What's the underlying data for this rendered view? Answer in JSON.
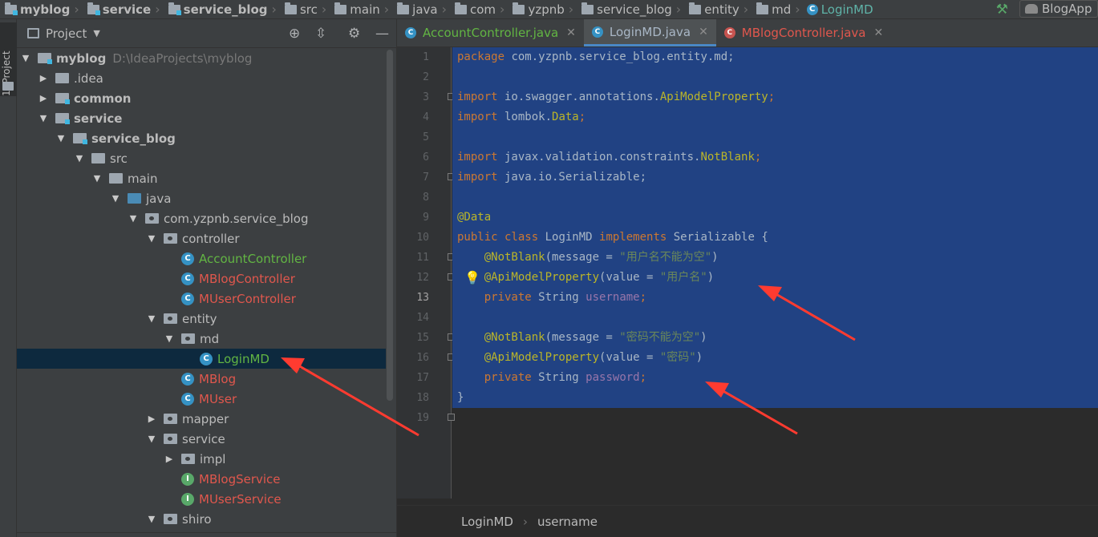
{
  "navbar": {
    "crumbs": [
      "myblog",
      "service",
      "service_blog",
      "src",
      "main",
      "java",
      "com",
      "yzpnb",
      "service_blog",
      "entity",
      "md",
      "LoginMD"
    ],
    "run_config": "BlogApp"
  },
  "strip": {
    "tab_label": "1: Project"
  },
  "project": {
    "title": "Project",
    "tree": [
      {
        "label": "myblog",
        "path": "D:\\IdeaProjects\\myblog"
      },
      {
        "label": ".idea"
      },
      {
        "label": "common"
      },
      {
        "label": "service"
      },
      {
        "label": "service_blog"
      },
      {
        "label": "src"
      },
      {
        "label": "main"
      },
      {
        "label": "java"
      },
      {
        "label": "com.yzpnb.service_blog"
      },
      {
        "label": "controller"
      },
      {
        "label": "AccountController"
      },
      {
        "label": "MBlogController"
      },
      {
        "label": "MUserController"
      },
      {
        "label": "entity"
      },
      {
        "label": "md"
      },
      {
        "label": "LoginMD"
      },
      {
        "label": "MBlog"
      },
      {
        "label": "MUser"
      },
      {
        "label": "mapper"
      },
      {
        "label": "service"
      },
      {
        "label": "impl"
      },
      {
        "label": "MBlogService"
      },
      {
        "label": "MUserService"
      },
      {
        "label": "shiro"
      }
    ]
  },
  "editor": {
    "tabs": [
      {
        "label": "AccountController.java"
      },
      {
        "label": "LoginMD.java"
      },
      {
        "label": "MBlogController.java"
      }
    ],
    "line_numbers": [
      "1",
      "2",
      "3",
      "4",
      "5",
      "6",
      "7",
      "8",
      "9",
      "10",
      "11",
      "12",
      "13",
      "14",
      "15",
      "16",
      "17",
      "18",
      "19"
    ],
    "code": {
      "l1": {
        "kw": "package",
        "rest": " com.yzpnb.service_blog.entity.md;"
      },
      "l3": {
        "kw": "import",
        "pre": " io.swagger.annotations.",
        "an": "ApiModelProperty",
        "post": ";"
      },
      "l4": {
        "kw": "import",
        "pre": " lombok.",
        "an": "Data",
        "post": ";"
      },
      "l6": {
        "kw": "import",
        "pre": " javax.validation.constraints.",
        "an": "NotBlank",
        "post": ";"
      },
      "l7": {
        "kw": "import",
        "rest": " java.io.Serializable;"
      },
      "l9": {
        "an": "@Data"
      },
      "l10": {
        "kw1": "public class",
        "name": " LoginMD ",
        "kw2": "implements",
        "rest": " Serializable {"
      },
      "l11": {
        "an": "@NotBlank",
        "pre": "(message = ",
        "st": "\"用户名不能为空\"",
        "post": ")"
      },
      "l12": {
        "an": "@ApiModelProperty",
        "pre": "(value = ",
        "st": "\"用户名\"",
        "post": ")"
      },
      "l13": {
        "kw": "private",
        "type": " String ",
        "fd": "username",
        "post": ";"
      },
      "l15": {
        "an": "@NotBlank",
        "pre": "(message = ",
        "st": "\"密码不能为空\"",
        "post": ")"
      },
      "l16": {
        "an": "@ApiModelProperty",
        "pre": "(value = ",
        "st": "\"密码\"",
        "post": ")"
      },
      "l17": {
        "kw": "private",
        "type": " String ",
        "fd": "password",
        "post": ";"
      },
      "l18": {
        "rest": "}"
      }
    },
    "breadcrumb": [
      "LoginMD",
      "username"
    ]
  },
  "colors": {
    "selection": "#214283",
    "keyword": "#cc7832",
    "annotation": "#bbb529",
    "string": "#6a8759",
    "field": "#9876aa",
    "arrow": "#ff3b30"
  }
}
